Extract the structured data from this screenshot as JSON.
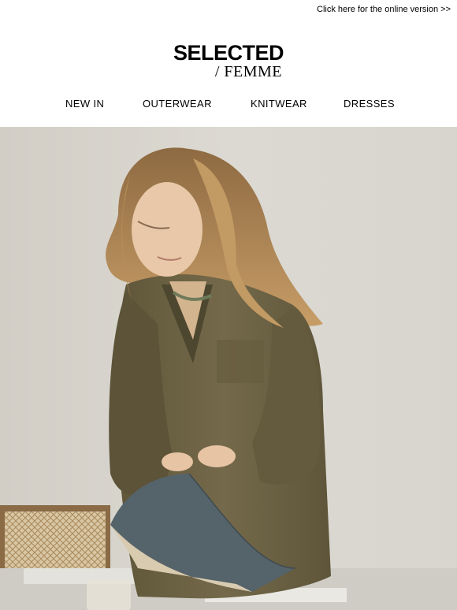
{
  "header": {
    "online_link": "Click here for the online version >>"
  },
  "brand": {
    "name": "SELECTED",
    "sub": "/ FEMME"
  },
  "nav": {
    "items": [
      {
        "label": "NEW IN"
      },
      {
        "label": "OUTERWEAR"
      },
      {
        "label": "KNITWEAR"
      },
      {
        "label": "DRESSES"
      }
    ]
  },
  "colors": {
    "wall": "#d6d3cc",
    "shirt": "#6e6446",
    "hair": "#b58a55",
    "book": "#5d6b70"
  }
}
